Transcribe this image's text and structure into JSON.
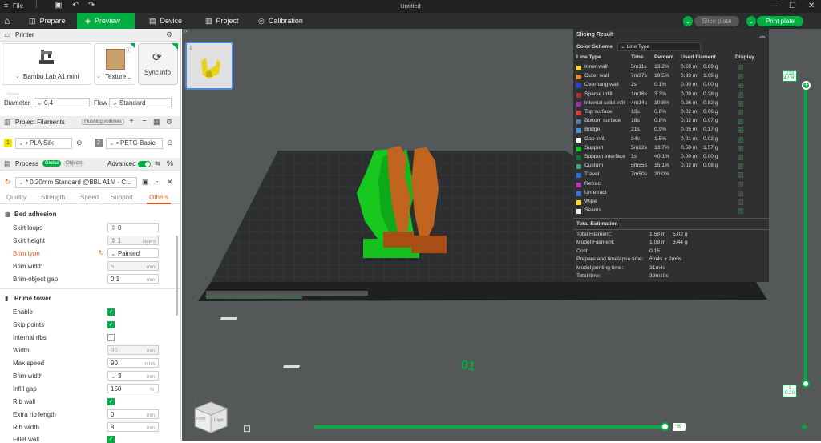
{
  "titlebar": {
    "file": "File",
    "title": "Untitled"
  },
  "tabs": [
    {
      "label": "Prepare"
    },
    {
      "label": "Preview"
    },
    {
      "label": "Device"
    },
    {
      "label": "Project"
    },
    {
      "label": "Calibration"
    }
  ],
  "actions": {
    "slice": "Slice plate",
    "print": "Print plate"
  },
  "printer": {
    "header": "Printer",
    "name": "Bambu Lab A1 mini",
    "plate": "Texture...",
    "sync": "Sync info",
    "diameter_label": "Diameter",
    "diameter": "0.4",
    "flow_label": "Flow",
    "flow": "Standard",
    "nozzle_hint": "Nozzle"
  },
  "filaments": {
    "header": "Project Filaments",
    "flushing": "Flushing volumes",
    "items": [
      {
        "idx": "1",
        "name": "PLA Silk",
        "color": "#f5e600"
      },
      {
        "idx": "2",
        "name": "PETG Basic",
        "color": "#888888"
      }
    ]
  },
  "process": {
    "header": "Process",
    "global": "Global",
    "objects": "Objects",
    "advanced": "Advanced",
    "preset": "* 0.20mm Standard @BBL A1M - C...",
    "tabs": [
      "Quality",
      "Strength",
      "Speed",
      "Support",
      "Others"
    ]
  },
  "bed_adhesion": {
    "title": "Bed adhesion",
    "skirt_loops_label": "Skirt loops",
    "skirt_loops": "0",
    "skirt_height_label": "Skirt height",
    "skirt_height": "1",
    "skirt_height_unit": "layers",
    "brim_type_label": "Brim type",
    "brim_type": "Painted",
    "brim_width_label": "Brim width",
    "brim_width": "5",
    "brim_gap_label": "Brim-object gap",
    "brim_gap": "0.1",
    "mm": "mm"
  },
  "prime_tower": {
    "title": "Prime tower",
    "enable": "Enable",
    "skip_points": "Skip points",
    "internal_ribs": "Internal ribs",
    "width_label": "Width",
    "width": "35",
    "max_speed_label": "Max speed",
    "max_speed": "90",
    "speed_unit": "mm/s",
    "brim_width_label": "Brim width",
    "brim_width": "3",
    "infill_gap_label": "Infill gap",
    "infill_gap": "150",
    "pct": "%",
    "rib_wall": "Rib wall",
    "extra_rib_label": "Extra rib length",
    "extra_rib": "0",
    "rib_width_label": "Rib width",
    "rib_width": "8",
    "fillet_wall": "Fillet wall"
  },
  "plate_thumb": {
    "num": "1"
  },
  "slicing": {
    "title": "Slicing Result",
    "color_scheme_label": "Color Scheme",
    "color_scheme": "Line Type",
    "headers": [
      "Line Type",
      "Time",
      "Percent",
      "Used filament",
      "Display"
    ],
    "rows": [
      {
        "name": "Inner wall",
        "color": "#f2e11c",
        "time": "5m11s",
        "pct": "13.2%",
        "len": "0.28 m",
        "g": "0.89 g",
        "on": true
      },
      {
        "name": "Outer wall",
        "color": "#f08b2a",
        "time": "7m37s",
        "pct": "19.5%",
        "len": "0.33 m",
        "g": "1.05 g",
        "on": true
      },
      {
        "name": "Overhang wall",
        "color": "#2742d6",
        "time": "2s",
        "pct": "0.1%",
        "len": "0.00 m",
        "g": "0.00 g",
        "on": true
      },
      {
        "name": "Sparse infill",
        "color": "#b22e2e",
        "time": "1m16s",
        "pct": "3.3%",
        "len": "0.09 m",
        "g": "0.28 g",
        "on": true
      },
      {
        "name": "Internal solid infill",
        "color": "#a32eb0",
        "time": "4m14s",
        "pct": "10.8%",
        "len": "0.26 m",
        "g": "0.82 g",
        "on": true
      },
      {
        "name": "Top surface",
        "color": "#e63a3a",
        "time": "13s",
        "pct": "0.6%",
        "len": "0.02 m",
        "g": "0.06 g",
        "on": true
      },
      {
        "name": "Bottom surface",
        "color": "#5b7fb0",
        "time": "18s",
        "pct": "0.8%",
        "len": "0.02 m",
        "g": "0.07 g",
        "on": true
      },
      {
        "name": "Bridge",
        "color": "#4d8fd6",
        "time": "21s",
        "pct": "0.9%",
        "len": "0.05 m",
        "g": "0.17 g",
        "on": true
      },
      {
        "name": "Gap infill",
        "color": "#ffffff",
        "time": "34s",
        "pct": "1.5%",
        "len": "0.01 m",
        "g": "0.02 g",
        "on": true
      },
      {
        "name": "Support",
        "color": "#00d21c",
        "time": "5m22s",
        "pct": "13.7%",
        "len": "0.50 m",
        "g": "1.57 g",
        "on": true
      },
      {
        "name": "Support interface",
        "color": "#1c6e2a",
        "time": "1s",
        "pct": "<0.1%",
        "len": "0.00 m",
        "g": "0.00 g",
        "on": true
      },
      {
        "name": "Custom",
        "color": "#3ea67a",
        "time": "5m55s",
        "pct": "15.1%",
        "len": "0.02 m",
        "g": "0.08 g",
        "on": true
      },
      {
        "name": "Travel",
        "color": "#3366e0",
        "time": "7m50s",
        "pct": "20.0%",
        "len": "",
        "g": "",
        "on": false
      },
      {
        "name": "Retract",
        "color": "#c233c2",
        "time": "",
        "pct": "",
        "len": "",
        "g": "",
        "on": false
      },
      {
        "name": "Unretract",
        "color": "#4477dd",
        "time": "",
        "pct": "",
        "len": "",
        "g": "",
        "on": false
      },
      {
        "name": "Wipe",
        "color": "#f2e11c",
        "time": "",
        "pct": "",
        "len": "",
        "g": "",
        "on": false
      },
      {
        "name": "Seams",
        "color": "#eeeeee",
        "time": "",
        "pct": "",
        "len": "",
        "g": "",
        "on": true
      }
    ],
    "total_title": "Total Estimation",
    "totals": [
      {
        "k": "Total Filament:",
        "v1": "1.58 m",
        "v2": "5.02 g"
      },
      {
        "k": "Model Filament:",
        "v1": "1.08 m",
        "v2": "3.44 g"
      },
      {
        "k": "Cost:",
        "v1": "0.15",
        "v2": ""
      },
      {
        "k": "Prepare and timelapse time:",
        "v1": "6m4s + 2m0s",
        "v2": ""
      },
      {
        "k": "Model printing time:",
        "v1": "31m4s",
        "v2": ""
      },
      {
        "k": "Total time:",
        "v1": "39m10s",
        "v2": ""
      }
    ]
  },
  "layer_slider": {
    "top_layer": "213",
    "top_height": "42.60",
    "bottom_layer": "1",
    "bottom_height": "0.20",
    "top_fraction": 1.0
  },
  "move_slider": {
    "value": "59",
    "fraction": 0.97
  },
  "plate_label": "01",
  "cube": {
    "front": "Front",
    "right": "Right"
  }
}
